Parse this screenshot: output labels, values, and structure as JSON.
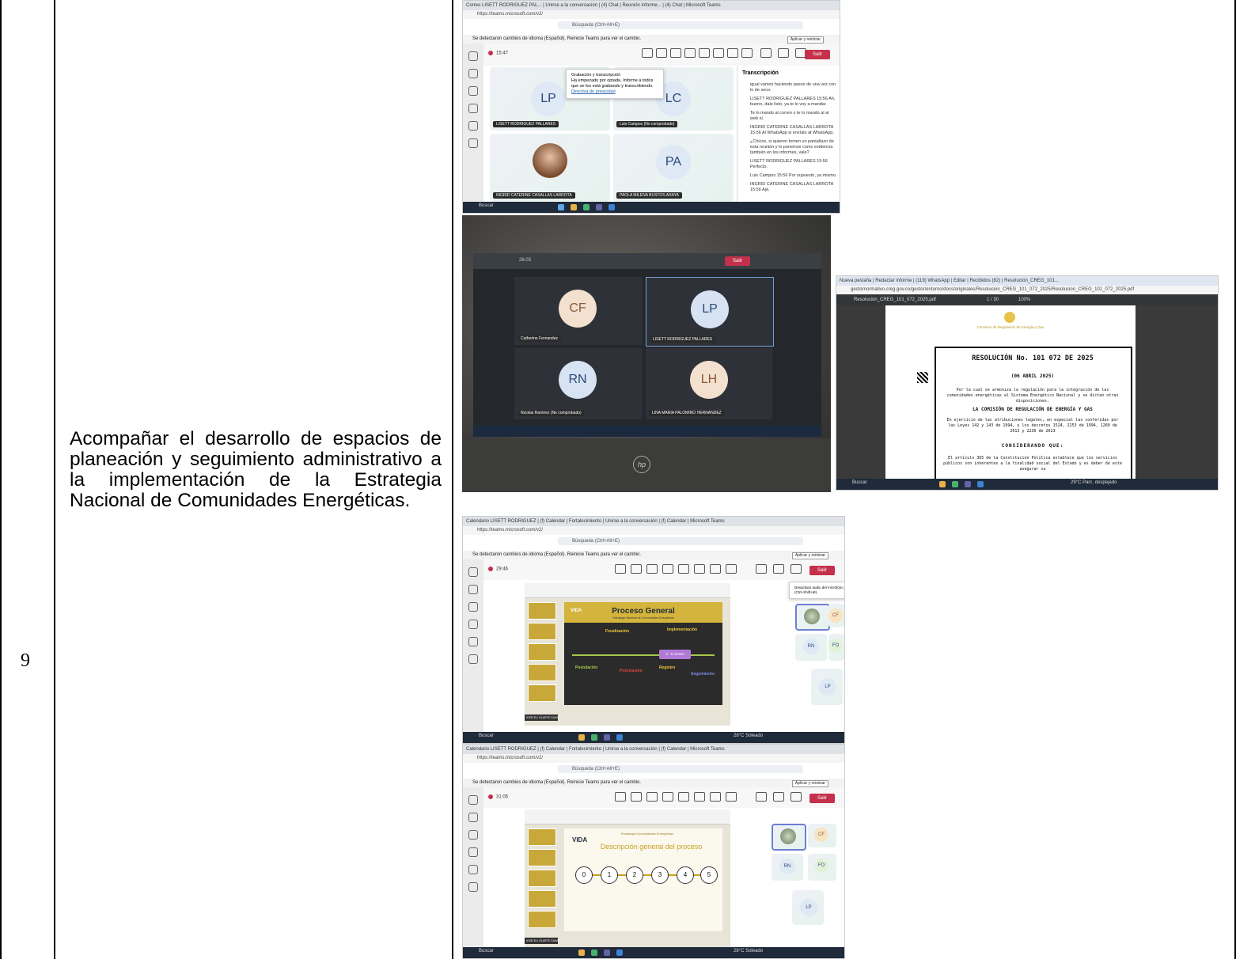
{
  "row": {
    "number": "9",
    "description": "Acompañar el desarrollo de espacios de planeación y seguimiento administrativo a la implementación de la Estrategia Nacional de Comunidades Energéticas."
  },
  "shot1": {
    "tabs": "Correo LISETT RODRIGUEZ PAL...  |  Unirse a la conversación  |  (4) Chat | Reunión informe...  |  (4) Chat | Microsoft Teams",
    "url": "https://teams.microsoft.com/v2/",
    "search": "Búsqueda (Ctrl+Alt+E)",
    "notice": "Se detectaron cambios de idioma (Español). Reinicie Teams para ver el cambio.",
    "notice_button": "Aplicar y reiniciar",
    "timer": "15:47",
    "leave": "Salir",
    "toolbar": [
      "Chat",
      "Gente",
      "Participar",
      "Reacciones",
      "Vista",
      "Notas",
      "Aplicaciones",
      "Más",
      "Cámara",
      "Micro",
      "Compartir"
    ],
    "popup_title": "Grabación y transcripción",
    "popup_text": "Ha empezado por optada. Informe a todos que se les está grabando y transcribiendo.",
    "popup_link": "Directiva de privacidad",
    "tiles": [
      {
        "initials": "LP",
        "name": "LISETT RODRIGUEZ PALLARES"
      },
      {
        "initials": "LC",
        "name": "Luis Campos (No comprobado)"
      },
      {
        "initials": "",
        "name": "INGRID CATERINE CASALLAS LARROTA"
      },
      {
        "initials": "PA",
        "name": "PAOLA MILENA BUSTOS ARAYA"
      }
    ],
    "panel_title": "Transcripción",
    "messages": [
      "igual vamos haciendo pasos de una vez con lo de seco.",
      "LISETT RODRIGUEZ PALLARES 15:56 Ah, bueno, dale listo, ya te lo voy a mandar.",
      "Te lo mando al correo o te lo mando al al web sí.",
      "INGRID CATERINE CASALLAS LARROTA 15:56 Al WhatsApp si envíalo al WhatsApp.",
      "¿Chicos, si quieren tomen un pantallazo de esta reunión y lo ponemos como evidencia también en los informes, vale?",
      "LISETT RODRIGUEZ PALLARES 15:56 Perfecto.",
      "Luis Campos 15:56 Por supuesto, ya mismo.",
      "INGRID CATERINE CASALLAS LARROTA 15:56 Ajá."
    ],
    "taskbar_search": "Buscar"
  },
  "shot2": {
    "timer": "26:03",
    "leave": "Salir",
    "tiles": [
      {
        "initials": "CF",
        "name": "Catherine Fernandez"
      },
      {
        "initials": "LP",
        "name": "LISETT RODRIGUEZ PALLARES"
      },
      {
        "initials": "RN",
        "name": "Nicolas Ramirez (No comprobado)"
      },
      {
        "initials": "LH",
        "name": "LINA MARIA PALOMINO HERNANDEZ"
      }
    ],
    "brand": "hp"
  },
  "shot3": {
    "tabs": "Nueva pestaña  |  Redactar informe  |  (119) WhatsApp  |  Editar  |  Recibidos (82)  |  Resolución_CREG_101...",
    "url": "gestornormativo.creg.gov.co/gestor/entorno/docs/originales/Resolucion_CREG_101_072_2025/Resolucion_CREG_101_072_2025.pdf",
    "file": "Resolución_CREG_101_072_2025.pdf",
    "page_info": "1 / 30",
    "zoom": "100%",
    "seal": "Comisión de Regulación de Energía y Gas",
    "title": "RESOLUCIÓN No. 101 072 DE 2025",
    "date": "(06 ABRIL 2025)",
    "summary": "Por la cual se armoniza la regulación para la integración de las comunidades energéticas al Sistema Energético Nacional y se dictan otras disposiciones.",
    "commission": "LA COMISIÓN DE REGULACIÓN DE ENERGÍA Y GAS",
    "powers": "En ejercicio de las atribuciones legales, en especial las conferidas por las Leyes 142 y 143 de 1994, y los decretos 1524, 2253 de 1994, 1260 de 2013 y 2236 de 2023",
    "considering": "CONSIDERANDO QUE:",
    "body": "El artículo 365 de la Constitución Política establece que los servicios públicos son inherentes a la finalidad social del Estado y es deber de este asegurar su",
    "weather": "29°C Parc. despejado",
    "taskbar_search": "Buscar"
  },
  "shot4": {
    "tabs": "Calendario LISETT RODRIGUEZ  |  (f) Calendar | Fortalecimiento  |  Unirse a la conversación  |  (f) Calendar | Microsoft Teams",
    "url": "https://teams.microsoft.com/v2/",
    "search": "Búsqueda (Ctrl+Alt+E)",
    "notice": "Se detectaron cambios de idioma (Español). Reinicie Teams para ver el cambio.",
    "notice_button": "Aplicar y reiniciar",
    "timer": "29:46",
    "leave": "Salir",
    "mic_tooltip": "Desactivar audio del micrófono (Ctrl+Shift+M)",
    "slide_title": "Proceso General",
    "slide_subtitle": "Estrategia Nacional de Comunidades Energéticas",
    "slide_brand": "VIDA",
    "slide_steps": [
      "Focalización",
      "Implementación",
      "Postulación",
      "Priorización",
      "Registro",
      "Seguimiento",
      "3 - 6 meses"
    ],
    "participants": [
      "CF",
      "RN",
      "FO",
      "LP"
    ],
    "presenter": "IGOR ELI OLARTE GUANDO",
    "weather": "28°C Soleado",
    "taskbar_search": "Buscar"
  },
  "shot5": {
    "tabs": "Calendario LISETT RODRIGUEZ  |  (f) Calendar | Fortalecimiento  |  Unirse a la conversación  |  (f) Calendar | Microsoft Teams",
    "url": "https://teams.microsoft.com/v2/",
    "search": "Búsqueda (Ctrl+Alt+E)",
    "notice": "Se detectaron cambios de idioma (Español). Reinicie Teams para ver el cambio.",
    "notice_button": "Aplicar y reiniciar",
    "timer": "31:05",
    "leave": "Salir",
    "slide_header": "Estrategia Comunidades Energéticas",
    "slide_brand": "VIDA",
    "slide_title": "Descripción general del proceso",
    "steps": [
      "0",
      "1",
      "2",
      "3",
      "4",
      "5"
    ],
    "participants": [
      "CF",
      "RN",
      "FO",
      "LP"
    ],
    "presenter": "IGOR ELI OLARTE GUANDO",
    "weather": "28°C Soleado",
    "taskbar_search": "Buscar"
  }
}
